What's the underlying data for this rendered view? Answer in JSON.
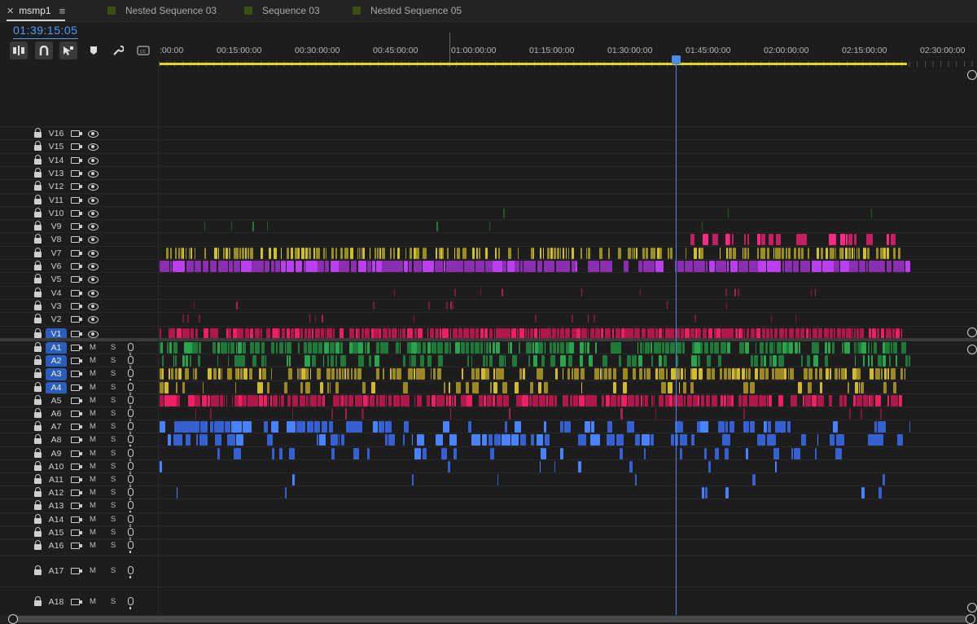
{
  "tabs": [
    {
      "label": "msmp1",
      "active": true
    },
    {
      "label": "Nested Sequence 03",
      "active": false
    },
    {
      "label": "Sequence 03",
      "active": false
    },
    {
      "label": "Nested Sequence 05",
      "active": false
    }
  ],
  "timecode": "01:39:15:05",
  "toolbar_icons": [
    "insert-overwrite-icon",
    "snap-magnet-icon",
    "linked-selection-icon",
    "add-marker-icon",
    "wrench-settings-icon",
    "captions-icon"
  ],
  "ruler": {
    "labels": [
      ":00:00",
      "00:15:00:00",
      "00:30:00:00",
      "00:45:00:00",
      "01:00:00:00",
      "01:15:00:00",
      "01:30:00:00",
      "01:45:00:00",
      "02:00:00:00",
      "02:15:00:00",
      "02:30:00:00"
    ]
  },
  "video_tracks": [
    "V16",
    "V15",
    "V14",
    "V13",
    "V12",
    "V11",
    "V10",
    "V9",
    "V8",
    "V7",
    "V6",
    "V5",
    "V4",
    "V3",
    "V2",
    "V1"
  ],
  "audio_tracks": [
    "A1",
    "A2",
    "A3",
    "A4",
    "A5",
    "A6",
    "A7",
    "A8",
    "A9",
    "A10",
    "A11",
    "A12",
    "A13",
    "A14",
    "A15",
    "A16",
    "A17",
    "A18"
  ],
  "selected_tracks": [
    "V1",
    "A1",
    "A2",
    "A3",
    "A4"
  ],
  "mute_label": "M",
  "solo_label": "S",
  "colors": {
    "accent": "#4a9eff",
    "workarea": "#e5d419",
    "v1": "#b0174a",
    "v6": "#b84a12",
    "v6b": "#8a2fb0",
    "v7": "#9a8e1e",
    "v8": "#c41f63",
    "a1": "#1f7a3a",
    "a3": "#9b8a22",
    "a5": "#b0174a",
    "a7": "#3560d0"
  }
}
